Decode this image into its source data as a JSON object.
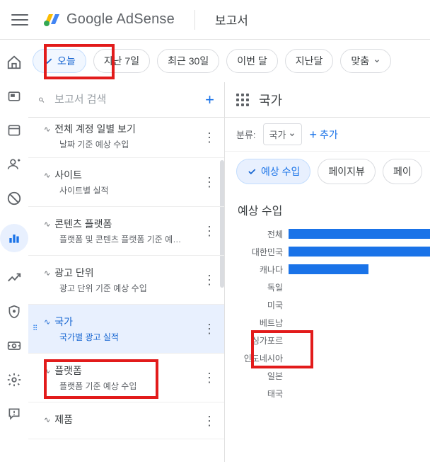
{
  "header": {
    "brand_g": "Google",
    "brand_a": " AdSense",
    "tab": "보고서"
  },
  "chips": {
    "today": "오늘",
    "last7": "지난 7일",
    "last30": "최근 30일",
    "this_month": "이번 달",
    "last_month": "지난달",
    "custom": "맞춤"
  },
  "search": {
    "placeholder": "보고서 검색"
  },
  "reports": [
    {
      "title": "전체 계정 일별 보기",
      "sub": "날짜 기준 예상 수입"
    },
    {
      "title": "사이트",
      "sub": "사이트별 실적"
    },
    {
      "title": "콘텐츠 플랫폼",
      "sub": "플랫폼 및 콘텐츠 플랫폼 기준 예…"
    },
    {
      "title": "광고 단위",
      "sub": "광고 단위 기준 예상 수입"
    },
    {
      "title": "국가",
      "sub": "국가별 광고 실적"
    },
    {
      "title": "플랫폼",
      "sub": "플랫폼 기준 예상 수입"
    },
    {
      "title": "제품",
      "sub": ""
    }
  ],
  "right": {
    "title": "국가",
    "breakdown_label": "분류:",
    "breakdown_value": "국가",
    "add_label": "추가",
    "metric_selected": "예상 수입",
    "metric_pageview": "페이지뷰",
    "metric_pagerpm": "페이",
    "chart_title": "예상 수입"
  },
  "chart_data": {
    "type": "bar",
    "title": "예상 수입",
    "xlabel": "",
    "ylabel": "",
    "categories": [
      "전체",
      "대한민국",
      "캐나다",
      "독일",
      "미국",
      "베트남",
      "싱가포르",
      "인도네시아",
      "일본",
      "태국"
    ],
    "values": [
      100,
      100,
      55,
      0,
      0,
      0,
      0,
      0,
      0,
      0
    ]
  }
}
